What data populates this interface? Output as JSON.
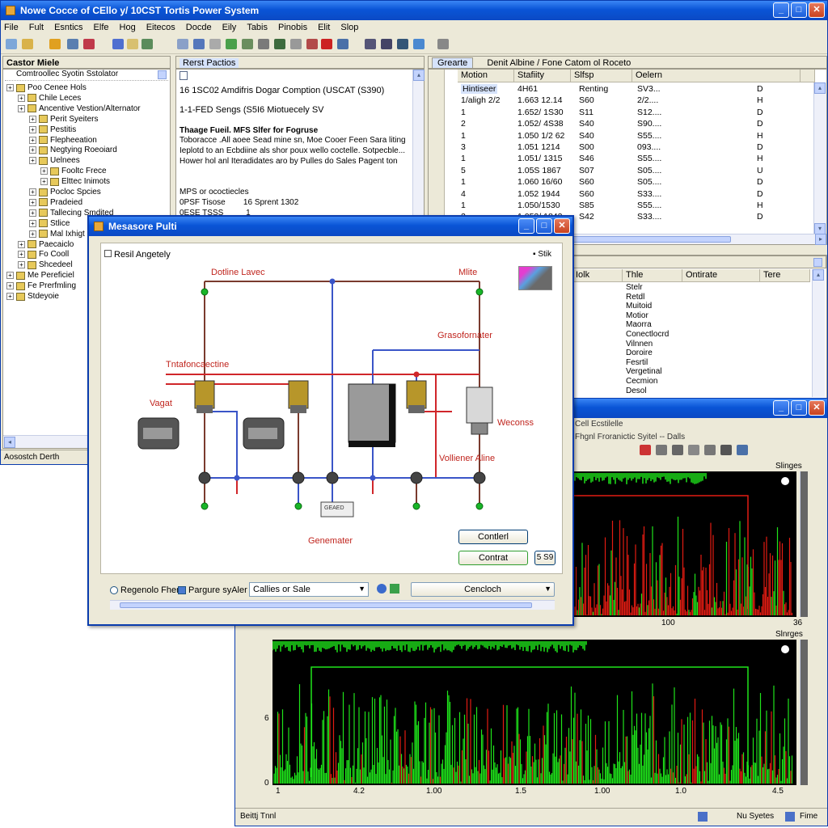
{
  "main_window": {
    "title": "Nowe Cocce of CEllo y/ 10CST Tortis Power System",
    "menu": [
      "File",
      "Fult",
      "Esntics",
      "Elfe",
      "Hog",
      "Eitecos",
      "Docde",
      "Eily",
      "Tabis",
      "Pinobis",
      "Elit",
      "Slop"
    ],
    "status_left": "Aosostch Derth"
  },
  "tree_pane": {
    "header": "Castor Miele",
    "subheader": "Comtroollec Syotin Sstolator",
    "items": [
      {
        "label": "Poo Cenee Hols",
        "level": 1
      },
      {
        "label": "Chile Leces",
        "level": 2
      },
      {
        "label": "Ancentive Vestion/Alternator",
        "level": 2
      },
      {
        "label": "Perit Syeiters",
        "level": 3
      },
      {
        "label": "Pestitis",
        "level": 3
      },
      {
        "label": "Flepheeation",
        "level": 3
      },
      {
        "label": "Negtying Roeoiard",
        "level": 3
      },
      {
        "label": "Uelnees",
        "level": 3
      },
      {
        "label": "Fooltc Frece",
        "level": 4
      },
      {
        "label": "Elttec Inimots",
        "level": 4
      },
      {
        "label": "Pocloc Spcies",
        "level": 3
      },
      {
        "label": "Pradeied",
        "level": 3
      },
      {
        "label": "Tallecing Smdited",
        "level": 3
      },
      {
        "label": "Stlice",
        "level": 3
      },
      {
        "label": "Mal Ixhigt",
        "level": 3
      },
      {
        "label": "Paecaiclo",
        "level": 2
      },
      {
        "label": "Fo Cooll",
        "level": 2
      },
      {
        "label": "Shcedeel",
        "level": 2
      },
      {
        "label": "Me Pereficiel",
        "level": 1
      },
      {
        "label": "Fe Prerfmling",
        "level": 1
      },
      {
        "label": "Stdeyoie",
        "level": 1
      }
    ]
  },
  "desc_pane": {
    "header": "Rerst Pactios",
    "lines": [
      "16 1SC02 Amdifris Dogar Comption (USCAT (S390)",
      "1-1-FED Sengs (S5I6 Miotuecely SV",
      "Thaage Fueil. MFS Slfer for Fogruse",
      "Toboracce .All aoee Sead mine sn, Moe Cooer Feen Sara liting",
      "Ieplotd to an Ecbdiine als shor poux wello coctelle. Sotpecble...",
      "Hower hol anl Iteradidates aro by Pulles do Sales Pagent ton",
      "MPS or ococtiecles",
      "0PSF Tisose        16 Sprent 1302",
      "0ESE TSSS          1"
    ]
  },
  "table_pane": {
    "tab": "Grearte",
    "header": "Denit Albine / Fone Catom ol Roceto",
    "columns": [
      "Motion",
      "Stafiity",
      "Slfsp",
      "Oelern"
    ],
    "rows": [
      [
        "Hintiseer",
        "4H61",
        "Renting",
        "SV3...",
        "D"
      ],
      [
        "1/aligh 2/2",
        "1.663 12.14",
        "S60",
        "2/2....",
        "H"
      ],
      [
        "1",
        "1.652/ 1S30",
        "S11",
        "S12....",
        "D"
      ],
      [
        "2",
        "1.052/ 4S38",
        "S40",
        "S90....",
        "D"
      ],
      [
        "1",
        "1.050 1/2 62",
        "S40",
        "S55....",
        "H"
      ],
      [
        "3",
        "1.051 1214",
        "S00",
        "093....",
        "D"
      ],
      [
        "1",
        "1.051/ 1315",
        "S46",
        "S55....",
        "H"
      ],
      [
        "5",
        "1.05S 1867",
        "S07",
        "S05....",
        "U"
      ],
      [
        "1",
        "1.060 16/60",
        "S60",
        "S05....",
        "D"
      ],
      [
        "4",
        "1.052 1944",
        "S60",
        "S33....",
        "D"
      ],
      [
        "1",
        "1.050/1530",
        "S85",
        "S55....",
        "H"
      ],
      [
        "2",
        "1.052/ 1842",
        "S42",
        "S33....",
        "D"
      ]
    ]
  },
  "list_pane": {
    "columns": [
      "Iolk",
      "Thle",
      "Ontirate",
      "Tere"
    ],
    "items": [
      "Stelr",
      "Retdl",
      "Muitoid",
      "Motior",
      "Maorra",
      "Conectlocrd",
      "Vilnnen",
      "Doroire",
      "Fesrtil",
      "Vergetinal",
      "Cecmion",
      "Desol"
    ]
  },
  "dialog": {
    "title": "Mesasore Pulti",
    "group_label": "Resil Angetely",
    "help": "Stik",
    "labels": {
      "top_left": "Dotline Lavec",
      "top_right": "Mlite",
      "transformer_right": "Grasofornater",
      "left_mid": "Tntafoncaectine",
      "voltage": "Vagat",
      "weconss": "Weconss",
      "valance": "Volliener Aline",
      "generator": "Genemater",
      "gen_box": "GEAED"
    },
    "btn_cancel": "Contlerl",
    "btn_control": "Contrat",
    "btn_small": "5 S9",
    "radio1": "Regenolo Fher",
    "check1": "Pargure syAler",
    "select1": "Callies or Sale",
    "select2": "Cencloch"
  },
  "plot_window": {
    "toolbar_title": "Cell Ecstilelle",
    "toolbar2": "Fhgnl Froranictic Syitel -- Dalls",
    "plot1_label": "Slinges",
    "plot1_x": [
      "100",
      "36"
    ],
    "plot2_label": "Slnrges",
    "plot2_x": [
      "1",
      "4.2",
      "1.00",
      "1.5",
      "1.00",
      "1.0",
      "4.5"
    ],
    "plot2_y": [
      "0",
      "6"
    ],
    "status_left": "Beittj Tnnl",
    "status_right": [
      "Nu Syetes",
      "Fime"
    ],
    "colors": {
      "green": "#1fe41a",
      "red": "#e21c12",
      "bg": "#000000"
    }
  }
}
